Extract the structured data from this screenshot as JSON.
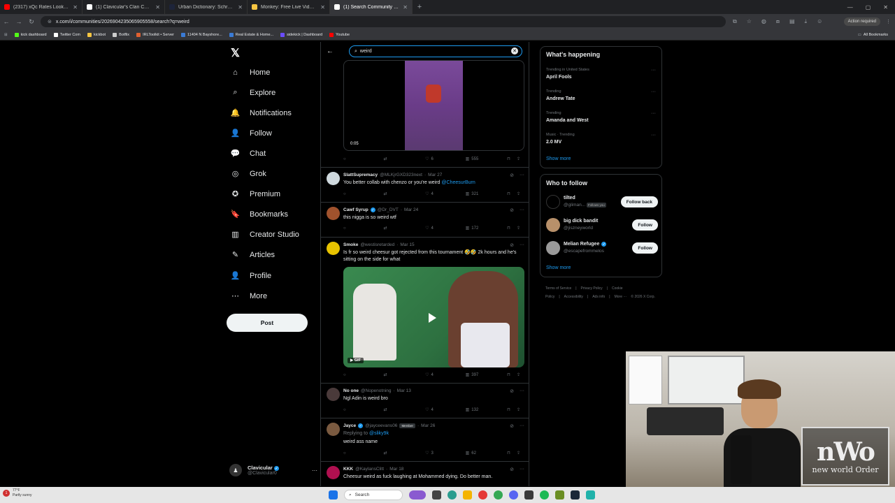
{
  "browser": {
    "tabs": [
      {
        "label": "(2317) xQc Rates Looksmaxxing",
        "color": "#ff0000"
      },
      {
        "label": "(1) Clavicular's Clan Community",
        "color": "#ffffff"
      },
      {
        "label": "Urban Dictionary: Schrodingers",
        "color": "#1d2439"
      },
      {
        "label": "Monkey: Free Live Video Ch...",
        "color": "#f5c542"
      },
      {
        "label": "(1) Search Community / X",
        "color": "#ffffff"
      }
    ],
    "url": "x.com/i/communities/2026904235065905558/search?q=weird",
    "action_required": "Action required",
    "bookmarks": [
      {
        "label": "kick dashboard",
        "color": "#53fc18"
      },
      {
        "label": "Twitter Com",
        "color": "#ffffff"
      },
      {
        "label": "kickbot",
        "color": "#f5c542"
      },
      {
        "label": "Botflix",
        "color": "#cccccc"
      },
      {
        "label": "IRLToolkit • Server",
        "color": "#e06030"
      },
      {
        "label": "11404 N Bayshore...",
        "color": "#3a7bd5"
      },
      {
        "label": "Real Estate & Home...",
        "color": "#3a7bd5"
      },
      {
        "label": "sidekick | Dashboard",
        "color": "#6a4cff"
      },
      {
        "label": "Youtube",
        "color": "#ff0000"
      }
    ],
    "all_bookmarks": "All Bookmarks"
  },
  "nav": {
    "logo": "𝕏",
    "items": [
      {
        "label": "Home",
        "icon": "⌂"
      },
      {
        "label": "Explore",
        "icon": "⌕"
      },
      {
        "label": "Notifications",
        "icon": "🔔"
      },
      {
        "label": "Follow",
        "icon": "👤"
      },
      {
        "label": "Chat",
        "icon": "💬"
      },
      {
        "label": "Grok",
        "icon": "◎"
      },
      {
        "label": "Premium",
        "icon": "✪"
      },
      {
        "label": "Bookmarks",
        "icon": "🔖"
      },
      {
        "label": "Creator Studio",
        "icon": "▥"
      },
      {
        "label": "Articles",
        "icon": "✎"
      },
      {
        "label": "Profile",
        "icon": "👤"
      },
      {
        "label": "More",
        "icon": "⋯"
      }
    ],
    "post_label": "Post",
    "account": {
      "name": "Clavicular",
      "handle": "@Clavicular0"
    }
  },
  "search": {
    "query": "weird"
  },
  "video": {
    "time": "0:05"
  },
  "actions_top": {
    "likes": "6",
    "views": "555"
  },
  "tweets": [
    {
      "name": "SlattSupremacy",
      "handle": "@MLKjrGXD323next",
      "date": "Mar 27",
      "verified": false,
      "text_pre": "You better collab with chenzo or you're weird ",
      "text_link": "@CheesurBurn",
      "likes": "4",
      "views": "321"
    },
    {
      "name": "Cawf Syrup",
      "handle": "@Dr_DVT",
      "date": "Mar 24",
      "verified": true,
      "text_pre": "this nigga is so weird wtf",
      "text_link": "",
      "likes": "4",
      "views": "172"
    },
    {
      "name": "Smoke",
      "handle": "@westisretarded",
      "date": "Mar 15",
      "verified": false,
      "text_pre": "Is fr so weird cheesur got rejected from this tournament 🤣🤣 2k hours and he's sitting on the side for what",
      "text_link": "",
      "likes": "4",
      "views": "397",
      "media": "GIF"
    },
    {
      "name": "No one",
      "handle": "@Nopenotning",
      "date": "Mar 13",
      "verified": false,
      "text_pre": "Ngl Adin is weird bro",
      "text_link": "",
      "likes": "4",
      "views": "132"
    },
    {
      "name": "Jayce",
      "handle": "@jayceevans06",
      "date": "Mar 26",
      "verified": true,
      "member": "Member",
      "replying_prefix": "Replying to ",
      "replying_to": "@sliky9k",
      "text_pre": "weird ass name",
      "text_link": "",
      "likes": "3",
      "views": "62"
    },
    {
      "name": "KKK",
      "handle": "@KaylansClitt",
      "date": "Mar 18",
      "verified": false,
      "text_pre": "Cheesur weird as fuck laughing at Mohammed dying. Do better man.",
      "text_link": ""
    }
  ],
  "happening": {
    "title": "What's happening",
    "trends": [
      {
        "context": "Trending in United States",
        "name": "April Fools"
      },
      {
        "context": "Trending",
        "name": "Andrew Tate"
      },
      {
        "context": "Trending",
        "name": "Amanda and West"
      },
      {
        "context": "Music · Trending",
        "name": "2.0 MV"
      }
    ],
    "show_more": "Show more"
  },
  "who_to_follow": {
    "title": "Who to follow",
    "users": [
      {
        "name": "tilted",
        "handle": "@gliman...",
        "badge": "Follows you",
        "button": "Follow back",
        "verified": false
      },
      {
        "name": "big dick bandit",
        "handle": "@jiszneyworld",
        "badge": "",
        "button": "Follow",
        "verified": false
      },
      {
        "name": "Melian Refugee",
        "handle": "@escapefrommelos",
        "badge": "",
        "button": "Follow",
        "verified": true
      }
    ],
    "show_more": "Show more"
  },
  "footer": {
    "links": [
      "Terms of Service",
      "|",
      "Privacy Policy",
      "|",
      "Cookie Policy",
      "|",
      "Accessibility",
      "|",
      "Ads info",
      "|",
      "More ···",
      "© 2026 X Corp."
    ]
  },
  "webcam": {
    "logo_big": "nWo",
    "logo_small": "new world Order"
  },
  "taskbar": {
    "temp": "77°F",
    "weather": "Partly sunny",
    "search": "Search",
    "weather_badge": "1"
  }
}
